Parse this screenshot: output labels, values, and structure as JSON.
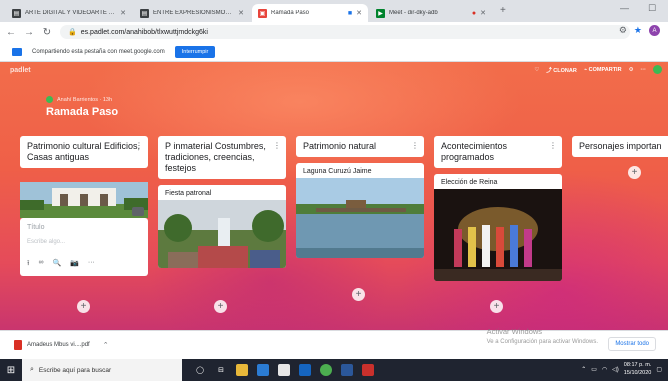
{
  "browser": {
    "tabs": [
      {
        "title": "ARTE DIGITAL Y VIDEOARTE - P…",
        "favicon_color": "#3c4043",
        "active": false
      },
      {
        "title": "ENTRE EXPRESIONISMOS Y EL E…",
        "favicon_color": "#3c4043",
        "active": false
      },
      {
        "title": "Ramada Paso",
        "favicon_color": "#e8453c",
        "active": true
      },
      {
        "title": "Meet - dir-dky-adb",
        "favicon_color": "#00832d",
        "active": false
      }
    ],
    "url": "es.padlet.com/anahibob/tlxwuttjmdckg6ki",
    "share_bar": {
      "text": "Compartiendo esta pestaña con meet.google.com",
      "stop_label": "Interrumpir"
    },
    "profile_initial": "A"
  },
  "padlet": {
    "logo": "padlet",
    "top_actions": [
      "♡",
      "⤴ CLONAR",
      "⌁ COMPARTIR",
      "⚙",
      "···"
    ],
    "author": "Anahí Barrientos  ·  13h",
    "title": "Ramada Paso",
    "columns": [
      {
        "header": "Patrimonio cultural Edificios, Casas antiguas",
        "draft": {
          "title_placeholder": "Título",
          "body_placeholder": "Escribe algo...",
          "tools": [
            "⭱",
            "∞",
            "🔍",
            "📷",
            "···"
          ]
        }
      },
      {
        "header": "P inmaterial Costumbres, tradiciones, creencias, festejos",
        "card_title": "Fiesta patronal"
      },
      {
        "header": "Patrimonio natural",
        "card_title": "Laguna Curuzú Jaime"
      },
      {
        "header": "Acontecimientos programados",
        "card_title": "Elección de Reina"
      },
      {
        "header": "Personajes importan"
      }
    ]
  },
  "downloads": {
    "item": "Amadeus Mbus vi....pdf",
    "show_all": "Mostrar todo",
    "watermark_title": "Activar Windows",
    "watermark_sub": "Ve a Configuración para activar Windows."
  },
  "taskbar": {
    "search_placeholder": "Escribe aquí para buscar",
    "time": "08:17 p. m.",
    "date": "15/10/2020"
  }
}
